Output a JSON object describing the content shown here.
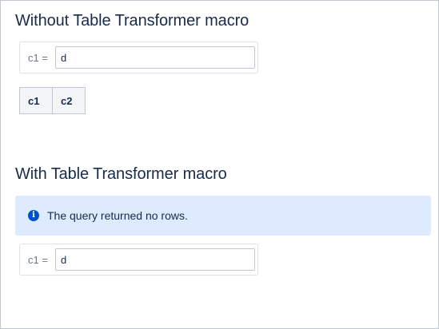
{
  "section_without": {
    "title": "Without Table Transformer macro",
    "parameter": {
      "label": "c1 =",
      "value": "d"
    },
    "table": {
      "columns": [
        "c1",
        "c2"
      ]
    }
  },
  "section_with": {
    "title": "With Table Transformer macro",
    "info_message": "The query returned no rows.",
    "info_icon": "info-icon",
    "parameter": {
      "label": "c1 =",
      "value": "d"
    }
  },
  "colors": {
    "heading_text": "#172b4d",
    "info_background": "#deebff",
    "info_icon": "#0052cc",
    "table_header_background": "#f4f5f7",
    "border": "#c1c7d0"
  }
}
